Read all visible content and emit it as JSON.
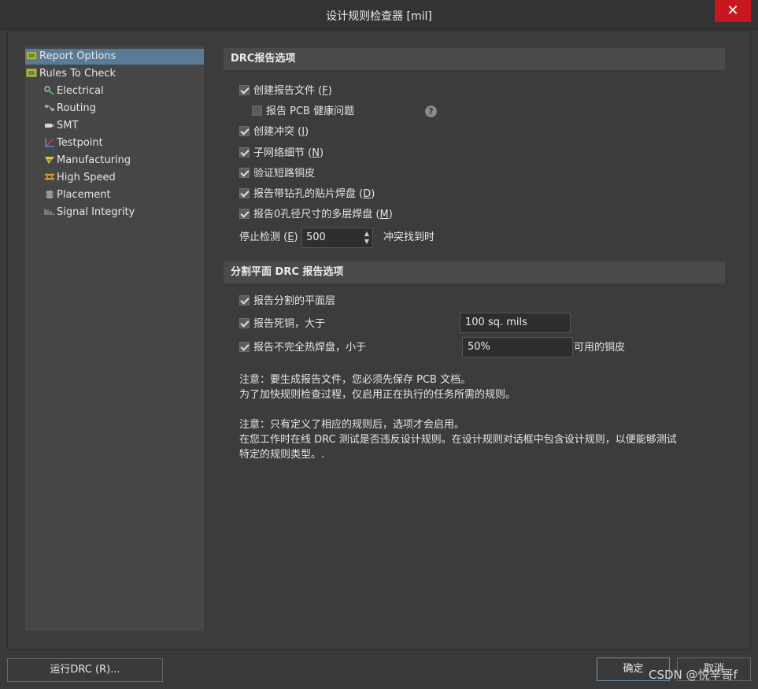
{
  "window": {
    "title": "设计规则检查器 [mil]",
    "close_label": "✕"
  },
  "tree": {
    "items": [
      {
        "label": "Report Options",
        "icon": "folder-icon"
      },
      {
        "label": "Rules To Check",
        "icon": "folder-icon"
      },
      {
        "label": "Electrical",
        "icon": "electrical-icon"
      },
      {
        "label": "Routing",
        "icon": "routing-icon"
      },
      {
        "label": "SMT",
        "icon": "smt-icon"
      },
      {
        "label": "Testpoint",
        "icon": "testpoint-icon"
      },
      {
        "label": "Manufacturing",
        "icon": "manufacturing-icon"
      },
      {
        "label": "High Speed",
        "icon": "high-speed-icon"
      },
      {
        "label": "Placement",
        "icon": "placement-icon"
      },
      {
        "label": "Signal Integrity",
        "icon": "signal-integrity-icon"
      }
    ]
  },
  "drc_options": {
    "header": "DRC报告选项",
    "create_report": {
      "label": "创建报告文件",
      "key": "F",
      "checked": true
    },
    "pcb_health": {
      "label": "报告 PCB 健康问题",
      "checked": false
    },
    "create_violations": {
      "label": "创建冲突",
      "key": "I",
      "checked": true
    },
    "subnet_details": {
      "label": "子网络细节",
      "key": "N",
      "checked": true
    },
    "verify_shorting": {
      "label": "验证短路铜皮",
      "checked": true
    },
    "drilled_smd": {
      "label": "报告带钻孔的贴片焊盘",
      "key": "D",
      "checked": true
    },
    "zero_hole": {
      "label": "报告0孔径尺寸的多层焊盘",
      "key": "M",
      "checked": true
    },
    "stop_label": "停止检测",
    "stop_key": "E",
    "stop_value": "500",
    "stop_suffix": "冲突找到时"
  },
  "split_plane": {
    "header": "分割平面 DRC 报告选项",
    "report_split": {
      "label": "报告分割的平面层",
      "checked": true
    },
    "dead_copper": {
      "label": "报告死铜，大于",
      "checked": true,
      "value": "100 sq. mils"
    },
    "thermal": {
      "label": "报告不完全热焊盘，小于",
      "checked": true,
      "value": "50%",
      "suffix": "可用的铜皮"
    }
  },
  "notes": {
    "line1": "注意：要生成报告文件，您必须先保存 PCB 文档。",
    "line2": "为了加快规则检查过程，仅启用正在执行的任务所需的规则。",
    "line3": "注意：只有定义了相应的规则后，选项才会启用。",
    "line4": "在您工作时在线 DRC 测试是否违反设计规则。在设计规则对话框中包含设计规则，以便能够测试",
    "line5": "特定的规则类型。."
  },
  "buttons": {
    "run": "运行DRC (R)...",
    "ok": "确定",
    "cancel": "取消"
  },
  "watermark": "CSDN @悦辛哥f"
}
